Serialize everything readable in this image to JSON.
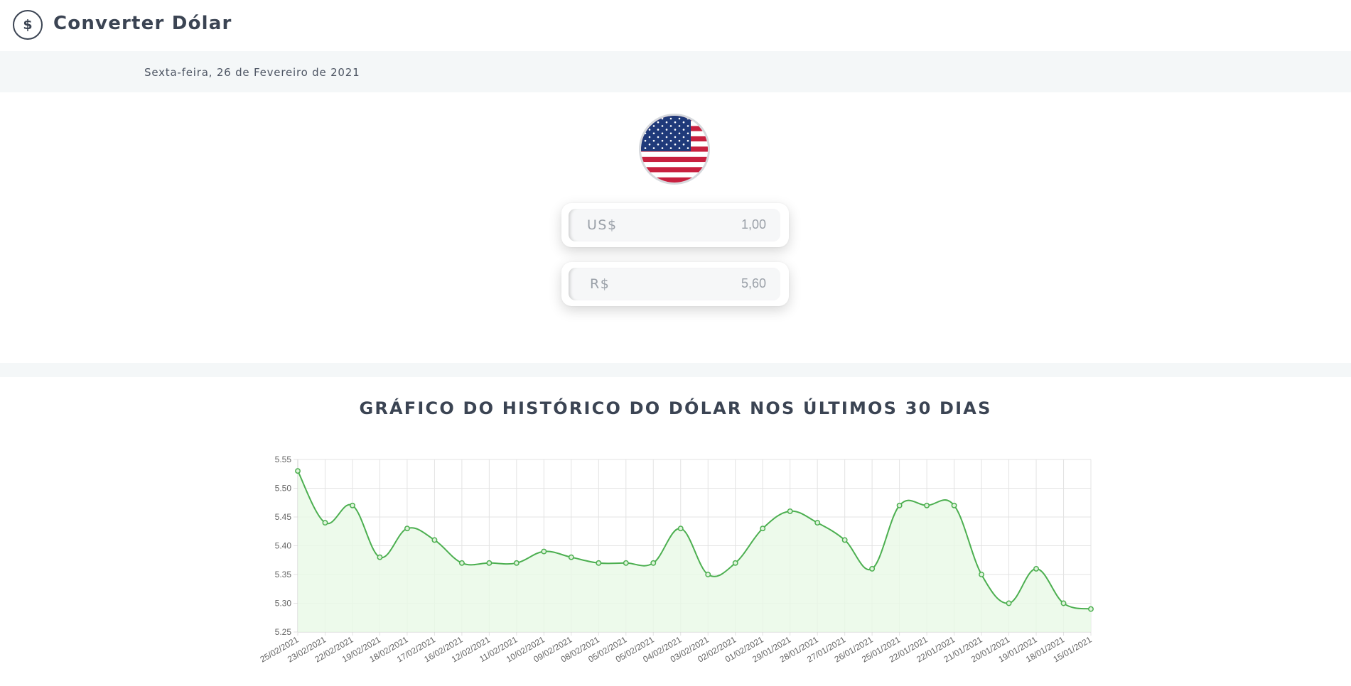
{
  "header": {
    "logo_symbol": "$",
    "title": "Converter Dólar"
  },
  "date_line": "Sexta-feira, 26 de Fevereiro de 2021",
  "flag": {
    "icon": "us-flag-icon"
  },
  "usd_field": {
    "prefix": "US$",
    "value": "1,00"
  },
  "brl_field": {
    "prefix": "R$",
    "value": "5,60"
  },
  "chart_section": {
    "title": "GRÁFICO DO HISTÓRICO DO DÓLAR NOS ÚLTIMOS 30 DIAS"
  },
  "colors": {
    "line": "#4caf50",
    "fill": "#e9f9e6",
    "grid": "#e3e3e3",
    "text": "#3b4453"
  },
  "chart_data": {
    "type": "line",
    "x": [
      "25/02/2021",
      "23/02/2021",
      "22/02/2021",
      "19/02/2021",
      "18/02/2021",
      "17/02/2021",
      "16/02/2021",
      "12/02/2021",
      "11/02/2021",
      "10/02/2021",
      "09/02/2021",
      "08/02/2021",
      "05/02/2021",
      "05/02/2021",
      "04/02/2021",
      "03/02/2021",
      "02/02/2021",
      "01/02/2021",
      "29/01/2021",
      "28/01/2021",
      "27/01/2021",
      "26/01/2021",
      "25/01/2021",
      "22/01/2021",
      "22/01/2021",
      "21/01/2021",
      "20/01/2021",
      "19/01/2021",
      "18/01/2021",
      "15/01/2021"
    ],
    "values": [
      5.53,
      5.44,
      5.47,
      5.38,
      5.43,
      5.41,
      5.37,
      5.37,
      5.37,
      5.39,
      5.38,
      5.37,
      5.37,
      5.37,
      5.43,
      5.35,
      5.37,
      5.43,
      5.46,
      5.44,
      5.41,
      5.36,
      5.47,
      5.47,
      5.47,
      5.35,
      5.3,
      5.36,
      5.3,
      5.29
    ],
    "ylim": [
      5.25,
      5.55
    ],
    "yticks": [
      "5.55",
      "5.50",
      "5.45",
      "5.40",
      "5.35",
      "5.30",
      "5.25"
    ],
    "grid": true,
    "legend": "none"
  }
}
